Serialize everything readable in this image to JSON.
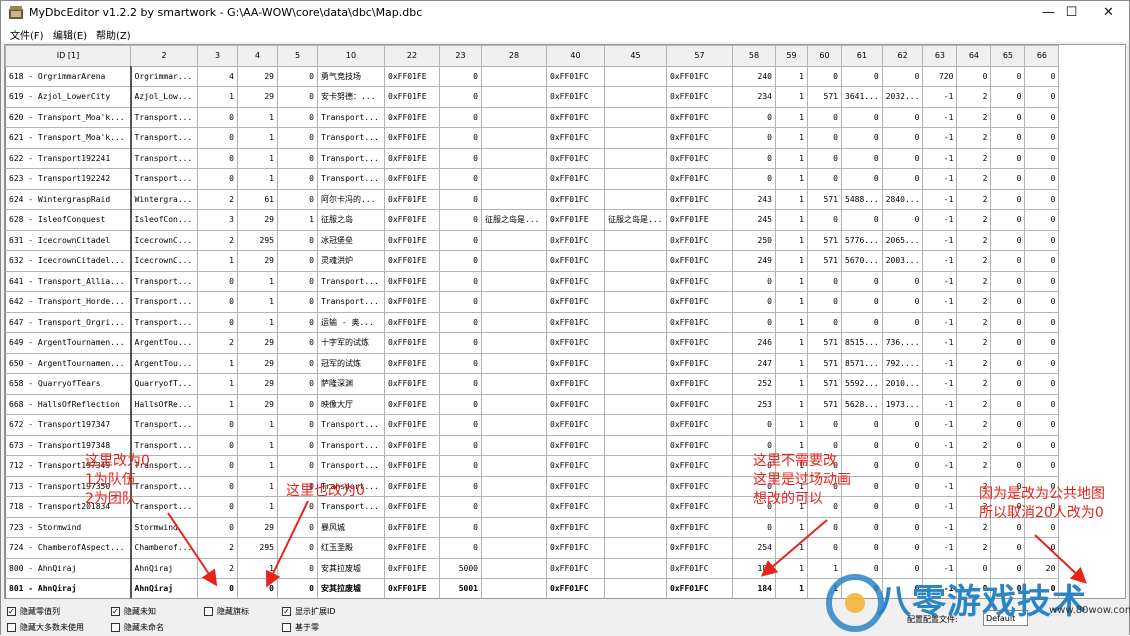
{
  "window": {
    "title": "MyDbcEditor v1.2.2 by smartwork - G:\\AA-WOW\\core\\data\\dbc\\Map.dbc",
    "minimize": "—",
    "maximize": "☐",
    "close": "✕"
  },
  "menu": [
    "文件(F)",
    "编辑(E)",
    "帮助(Z)"
  ],
  "columns": [
    "ID [1]",
    "2",
    "3",
    "4",
    "5",
    "10",
    "22",
    "23",
    "28",
    "40",
    "45",
    "57",
    "58",
    "59",
    "60",
    "61",
    "62",
    "63",
    "64",
    "65",
    "66"
  ],
  "rows": [
    [
      "618 - OrgrimmarArena",
      "Orgrimmar...",
      "4",
      "29",
      "0",
      "勇气竞技场",
      "0xFF01FE",
      "0",
      "",
      "0xFF01FC",
      "",
      "0xFF01FC",
      "240",
      "1",
      "0",
      "0",
      "0",
      "720",
      "0",
      "0",
      "0"
    ],
    [
      "619 - Azjol_LowerCity",
      "Azjol_Low...",
      "1",
      "29",
      "0",
      "安卡努德：...",
      "0xFF01FE",
      "0",
      "",
      "0xFF01FC",
      "",
      "0xFF01FC",
      "234",
      "1",
      "571",
      "3641...",
      "2032...",
      "-1",
      "2",
      "0",
      "0"
    ],
    [
      "620 - Transport_Moa'k...",
      "Transport...",
      "0",
      "1",
      "0",
      "Transport...",
      "0xFF01FE",
      "0",
      "",
      "0xFF01FC",
      "",
      "0xFF01FC",
      "0",
      "1",
      "0",
      "0",
      "0",
      "-1",
      "2",
      "0",
      "0"
    ],
    [
      "621 - Transport_Moa'k...",
      "Transport...",
      "0",
      "1",
      "0",
      "Transport...",
      "0xFF01FE",
      "0",
      "",
      "0xFF01FC",
      "",
      "0xFF01FC",
      "0",
      "1",
      "0",
      "0",
      "0",
      "-1",
      "2",
      "0",
      "0"
    ],
    [
      "622 - Transport192241",
      "Transport...",
      "0",
      "1",
      "0",
      "Transport...",
      "0xFF01FE",
      "0",
      "",
      "0xFF01FC",
      "",
      "0xFF01FC",
      "0",
      "1",
      "0",
      "0",
      "0",
      "-1",
      "2",
      "0",
      "0"
    ],
    [
      "623 - Transport192242",
      "Transport...",
      "0",
      "1",
      "0",
      "Transport...",
      "0xFF01FE",
      "0",
      "",
      "0xFF01FC",
      "",
      "0xFF01FC",
      "0",
      "1",
      "0",
      "0",
      "0",
      "-1",
      "2",
      "0",
      "0"
    ],
    [
      "624 - WintergraspRaid",
      "Wintergra...",
      "2",
      "61",
      "0",
      "阿尔卡冯的...",
      "0xFF01FE",
      "0",
      "",
      "0xFF01FC",
      "",
      "0xFF01FC",
      "243",
      "1",
      "571",
      "5488...",
      "2840...",
      "-1",
      "2",
      "0",
      "0"
    ],
    [
      "628 - IsleofConquest",
      "IsleofCon...",
      "3",
      "29",
      "1",
      "征服之岛",
      "0xFF01FE",
      "0",
      "征服之岛是...",
      "0xFF01FE",
      "征服之岛是...",
      "0xFF01FE",
      "245",
      "1",
      "0",
      "0",
      "0",
      "-1",
      "2",
      "0",
      "0"
    ],
    [
      "631 - IcecrownCitadel",
      "IcecrownC...",
      "2",
      "295",
      "0",
      "冰冠堡垒",
      "0xFF01FE",
      "0",
      "",
      "0xFF01FC",
      "",
      "0xFF01FC",
      "250",
      "1",
      "571",
      "5776...",
      "2065...",
      "-1",
      "2",
      "0",
      "0"
    ],
    [
      "632 - IcecrownCitadel...",
      "IcecrownC...",
      "1",
      "29",
      "0",
      "灵魂洪炉",
      "0xFF01FE",
      "0",
      "",
      "0xFF01FC",
      "",
      "0xFF01FC",
      "249",
      "1",
      "571",
      "5670...",
      "2003...",
      "-1",
      "2",
      "0",
      "0"
    ],
    [
      "641 - Transport_Allia...",
      "Transport...",
      "0",
      "1",
      "0",
      "Transport...",
      "0xFF01FE",
      "0",
      "",
      "0xFF01FC",
      "",
      "0xFF01FC",
      "0",
      "1",
      "0",
      "0",
      "0",
      "-1",
      "2",
      "0",
      "0"
    ],
    [
      "642 - Transport_Horde...",
      "Transport...",
      "0",
      "1",
      "0",
      "Transport...",
      "0xFF01FE",
      "0",
      "",
      "0xFF01FC",
      "",
      "0xFF01FC",
      "0",
      "1",
      "0",
      "0",
      "0",
      "-1",
      "2",
      "0",
      "0"
    ],
    [
      "647 - Transport_Orgri...",
      "Transport...",
      "0",
      "1",
      "0",
      "运输 - 奥...",
      "0xFF01FE",
      "0",
      "",
      "0xFF01FC",
      "",
      "0xFF01FC",
      "0",
      "1",
      "0",
      "0",
      "0",
      "-1",
      "2",
      "0",
      "0"
    ],
    [
      "649 - ArgentTournamen...",
      "ArgentTou...",
      "2",
      "29",
      "0",
      "十字军的试炼",
      "0xFF01FE",
      "0",
      "",
      "0xFF01FC",
      "",
      "0xFF01FC",
      "246",
      "1",
      "571",
      "8515...",
      "736....",
      "-1",
      "2",
      "0",
      "0"
    ],
    [
      "650 - ArgentTournamen...",
      "ArgentTou...",
      "1",
      "29",
      "0",
      "冠军的试炼",
      "0xFF01FE",
      "0",
      "",
      "0xFF01FC",
      "",
      "0xFF01FC",
      "247",
      "1",
      "571",
      "8571...",
      "792....",
      "-1",
      "2",
      "0",
      "0"
    ],
    [
      "658 - QuarryofTears",
      "QuarryofT...",
      "1",
      "29",
      "0",
      "萨隆深渊",
      "0xFF01FE",
      "0",
      "",
      "0xFF01FC",
      "",
      "0xFF01FC",
      "252",
      "1",
      "571",
      "5592...",
      "2010...",
      "-1",
      "2",
      "0",
      "0"
    ],
    [
      "668 - HallsOfReflection",
      "HallsOfRe...",
      "1",
      "29",
      "0",
      "映像大厅",
      "0xFF01FE",
      "0",
      "",
      "0xFF01FC",
      "",
      "0xFF01FC",
      "253",
      "1",
      "571",
      "5628...",
      "1973...",
      "-1",
      "2",
      "0",
      "0"
    ],
    [
      "672 - Transport197347",
      "Transport...",
      "0",
      "1",
      "0",
      "Transport...",
      "0xFF01FE",
      "0",
      "",
      "0xFF01FC",
      "",
      "0xFF01FC",
      "0",
      "1",
      "0",
      "0",
      "0",
      "-1",
      "2",
      "0",
      "0"
    ],
    [
      "673 - Transport197348",
      "Transport...",
      "0",
      "1",
      "0",
      "Transport...",
      "0xFF01FE",
      "0",
      "",
      "0xFF01FC",
      "",
      "0xFF01FC",
      "0",
      "1",
      "0",
      "0",
      "0",
      "-1",
      "2",
      "0",
      "0"
    ],
    [
      "712 - Transport197349",
      "Transport...",
      "0",
      "1",
      "0",
      "Transport...",
      "0xFF01FE",
      "0",
      "",
      "0xFF01FC",
      "",
      "0xFF01FC",
      "0",
      "1",
      "0",
      "0",
      "0",
      "-1",
      "2",
      "0",
      "0"
    ],
    [
      "713 - Transport197350",
      "Transport...",
      "0",
      "1",
      "0",
      "Transport...",
      "0xFF01FE",
      "0",
      "",
      "0xFF01FC",
      "",
      "0xFF01FC",
      "0",
      "1",
      "0",
      "0",
      "0",
      "-1",
      "2",
      "0",
      "0"
    ],
    [
      "718 - Transport201834",
      "Transport...",
      "0",
      "1",
      "0",
      "Transport...",
      "0xFF01FE",
      "0",
      "",
      "0xFF01FC",
      "",
      "0xFF01FC",
      "0",
      "1",
      "0",
      "0",
      "0",
      "-1",
      "2",
      "0",
      "0"
    ],
    [
      "723 - Stormwind",
      "Stormwind",
      "0",
      "29",
      "0",
      "暴风城",
      "0xFF01FE",
      "0",
      "",
      "0xFF01FC",
      "",
      "0xFF01FC",
      "0",
      "1",
      "0",
      "0",
      "0",
      "-1",
      "2",
      "0",
      "0"
    ],
    [
      "724 - ChamberofAspect...",
      "Chamberof...",
      "2",
      "295",
      "0",
      "红玉圣殿",
      "0xFF01FE",
      "0",
      "",
      "0xFF01FC",
      "",
      "0xFF01FC",
      "254",
      "1",
      "0",
      "0",
      "0",
      "-1",
      "2",
      "0",
      "0"
    ],
    [
      "800 - AhnQiraj",
      "AhnQiraj",
      "2",
      "1",
      "0",
      "安其拉废墟",
      "0xFF01FE",
      "5000",
      "",
      "0xFF01FC",
      "",
      "0xFF01FC",
      "184",
      "1",
      "1",
      "0",
      "0",
      "-1",
      "0",
      "0",
      "20"
    ],
    [
      "801 - AhnQiraj",
      "AhnQiraj",
      "0",
      "0",
      "0",
      "安其拉废墟",
      "0xFF01FE",
      "5001",
      "",
      "0xFF01FC",
      "",
      "0xFF01FC",
      "184",
      "1",
      "1",
      "0",
      "0",
      "-1",
      "0",
      "0",
      "0"
    ]
  ],
  "footer": {
    "cb1": "隐藏零值列",
    "cb2": "隐藏未知",
    "cb3": "隐藏旗标",
    "cb4": "显示扩展ID",
    "cb5": "隐藏大多数未使用",
    "cb6": "隐藏未命名",
    "cb7": "基于零",
    "config_label": "配置配置文件:",
    "config_value": "Default"
  },
  "annotations": {
    "a1_line1": "这里改为0",
    "a1_line2": "1为队伍",
    "a1_line3": "2为团队",
    "a2": "这里也改为0",
    "a3_line1": "这里不需要改",
    "a3_line2": "这里是过场动画",
    "a3_line3": "想改的可以",
    "a4_line1": "因为是改为公共地图",
    "a4_line2": "所以取消20人改为0"
  },
  "watermark": {
    "text": "八零游戏技术",
    "small": "www.80wow.com"
  },
  "colors": {
    "annotation": "#e8231c",
    "watermark": "#2b84c6"
  }
}
